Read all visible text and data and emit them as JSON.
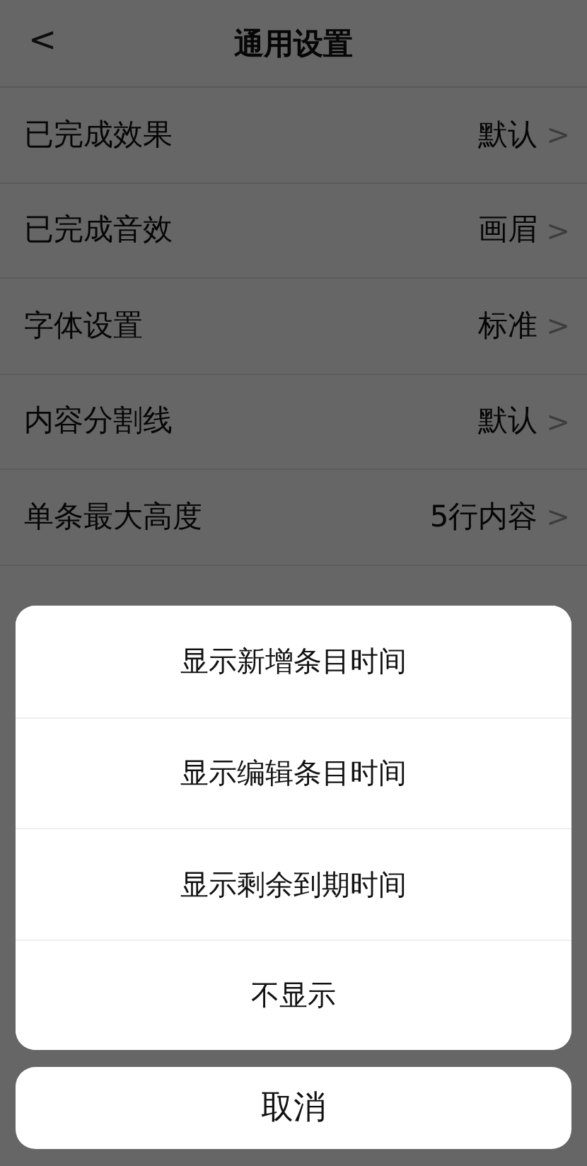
{
  "header": {
    "back": "<",
    "title": "通用设置"
  },
  "settings": [
    {
      "label": "已完成效果",
      "value": "默认",
      "chevron": ">"
    },
    {
      "label": "已完成音效",
      "value": "画眉",
      "chevron": ">"
    },
    {
      "label": "字体设置",
      "value": "标准",
      "chevron": ">"
    },
    {
      "label": "内容分割线",
      "value": "默认",
      "chevron": ">"
    },
    {
      "label": "单条最大高度",
      "value": "5行内容",
      "chevron": ">"
    }
  ],
  "action_sheet": {
    "options": [
      "显示新增条目时间",
      "显示编辑条目时间",
      "显示剩余到期时间",
      "不显示"
    ],
    "cancel": "取消"
  }
}
